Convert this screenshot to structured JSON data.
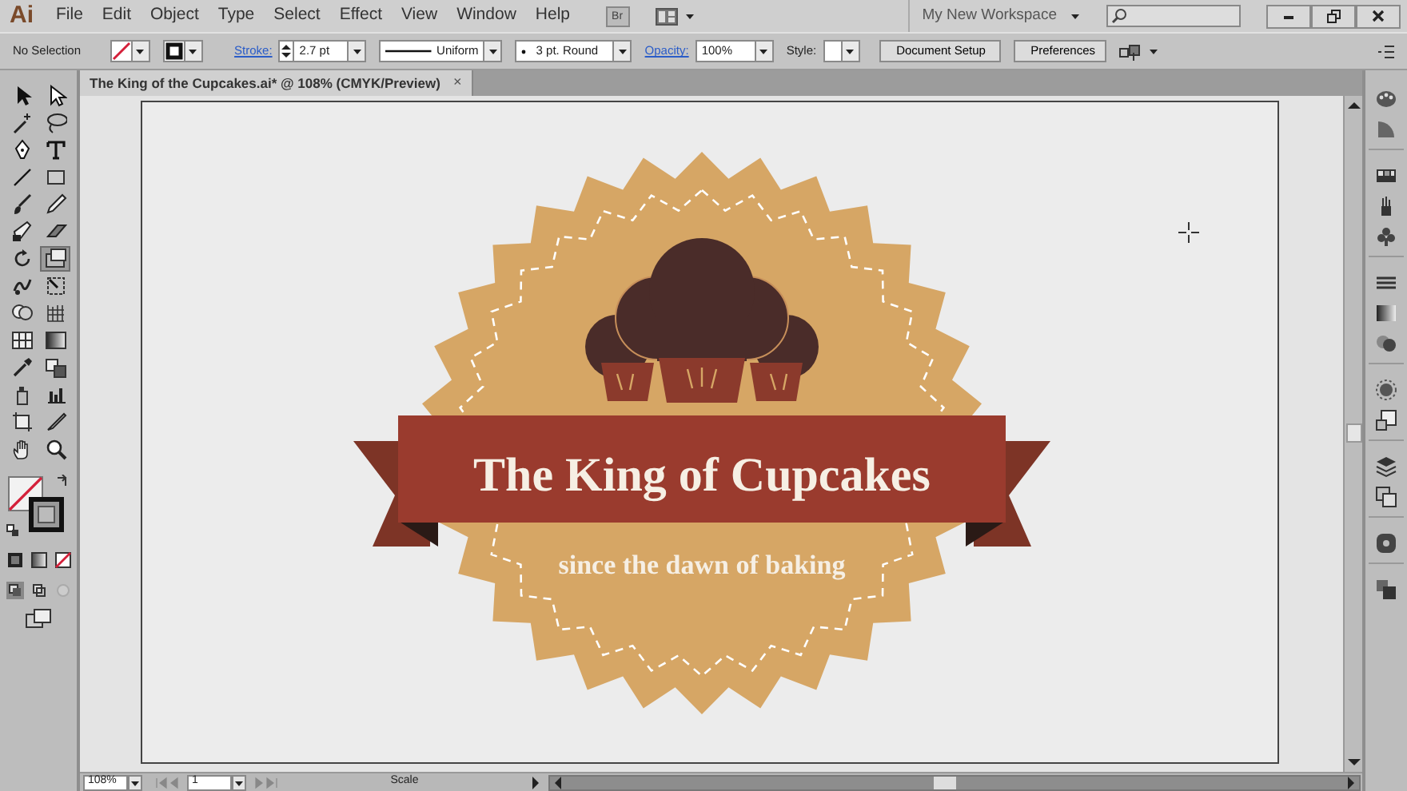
{
  "app": {
    "logo": "Ai",
    "menus": [
      "File",
      "Edit",
      "Object",
      "Type",
      "Select",
      "Effect",
      "View",
      "Window",
      "Help"
    ],
    "bridge_button": "Br",
    "workspace": "My New Workspace"
  },
  "control_bar": {
    "selection_label": "No Selection",
    "stroke_label": "Stroke:",
    "stroke_weight": "2.7 pt",
    "profile": "Uniform",
    "brush": "3 pt. Round",
    "opacity_label": "Opacity:",
    "opacity": "100%",
    "style_label": "Style:",
    "buttons": [
      "Document Setup",
      "Preferences"
    ]
  },
  "document_tab": {
    "title": "The King of the Cupcakes.ai* @ 108% (CMYK/Preview)",
    "close": "×"
  },
  "tools": [
    {
      "kind": "selection",
      "selected": false
    },
    {
      "kind": "direct",
      "selected": false
    },
    {
      "kind": "wand",
      "selected": false
    },
    {
      "kind": "lasso",
      "selected": false
    },
    {
      "kind": "pen",
      "selected": false
    },
    {
      "kind": "type",
      "selected": false
    },
    {
      "kind": "line",
      "selected": false
    },
    {
      "kind": "rect",
      "selected": false
    },
    {
      "kind": "brush",
      "selected": false
    },
    {
      "kind": "pencil",
      "selected": false
    },
    {
      "kind": "blob",
      "selected": false
    },
    {
      "kind": "eraser",
      "selected": false
    },
    {
      "kind": "rotate",
      "selected": false
    },
    {
      "kind": "scale",
      "selected": true
    },
    {
      "kind": "warp",
      "selected": false
    },
    {
      "kind": "transform",
      "selected": false
    },
    {
      "kind": "shape",
      "selected": false
    },
    {
      "kind": "grid",
      "selected": false
    },
    {
      "kind": "mesh",
      "selected": false
    },
    {
      "kind": "gradient",
      "selected": false
    },
    {
      "kind": "eyedropper",
      "selected": false
    },
    {
      "kind": "blend",
      "selected": false
    },
    {
      "kind": "sprayer",
      "selected": false
    },
    {
      "kind": "graph",
      "selected": false
    },
    {
      "kind": "artboard",
      "selected": false
    },
    {
      "kind": "slice",
      "selected": false
    },
    {
      "kind": "hand",
      "selected": false
    },
    {
      "kind": "zoom",
      "selected": false
    }
  ],
  "artwork": {
    "title": "The King of Cupcakes",
    "subtitle": "since the dawn of baking"
  },
  "status_bar": {
    "zoom": "108%",
    "artboard": "1",
    "status": "Scale"
  }
}
